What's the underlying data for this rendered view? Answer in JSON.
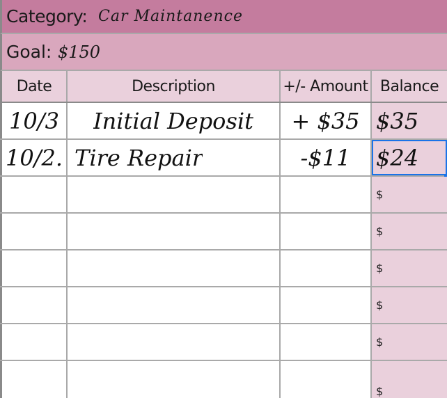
{
  "category": {
    "label": "Category:",
    "value": "Car Maintanence"
  },
  "goal": {
    "label": "Goal:",
    "value": "$150"
  },
  "columns": {
    "date": "Date",
    "description": "Description",
    "amount": "+/- Amount",
    "balance": "Balance"
  },
  "rows": [
    {
      "date": "10/3",
      "description": "Initial Deposit",
      "amount": "+ $35",
      "balance": "$35"
    },
    {
      "date": "10/2.",
      "description": "Tire Repair",
      "amount": "-$11",
      "balance": "$24"
    },
    {
      "date": "",
      "description": "",
      "amount": "",
      "balance": "$"
    },
    {
      "date": "",
      "description": "",
      "amount": "",
      "balance": "$"
    },
    {
      "date": "",
      "description": "",
      "amount": "",
      "balance": "$"
    },
    {
      "date": "",
      "description": "",
      "amount": "",
      "balance": "$"
    },
    {
      "date": "",
      "description": "",
      "amount": "",
      "balance": "$"
    },
    {
      "date": "",
      "description": "",
      "amount": "",
      "balance": "$"
    }
  ],
  "selection_color": "#1a73e8"
}
